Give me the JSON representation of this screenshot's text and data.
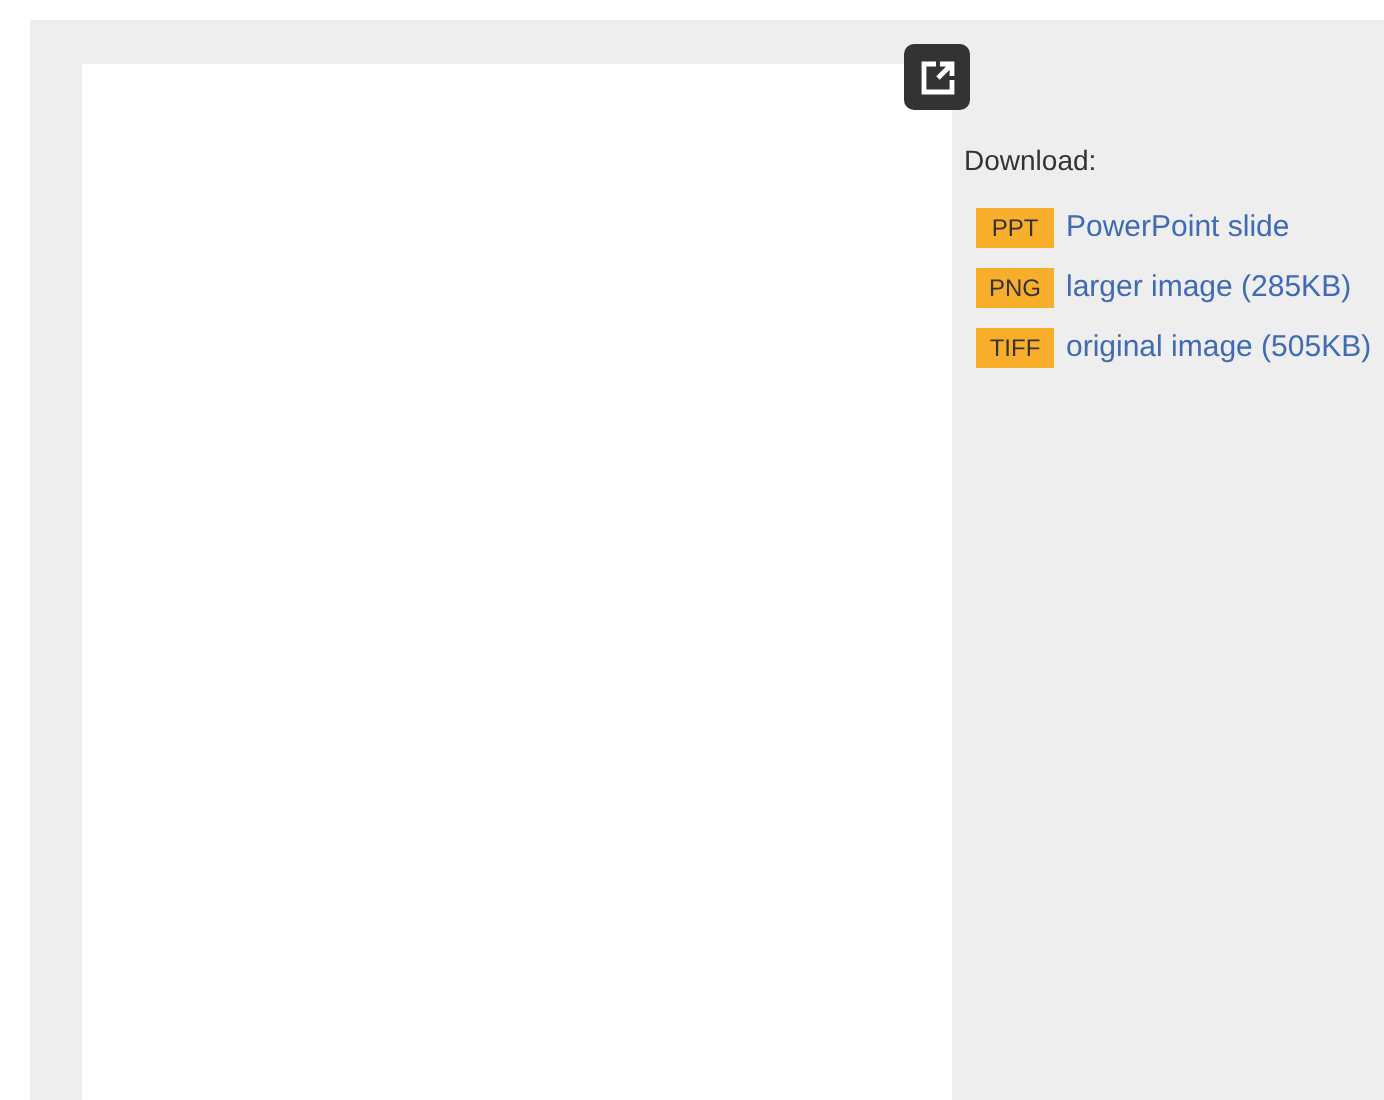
{
  "download": {
    "label": "Download:",
    "links": [
      {
        "badge": "PPT",
        "text": "PowerPoint slide"
      },
      {
        "badge": "PNG",
        "text": "larger image (285KB)"
      },
      {
        "badge": "TIFF",
        "text": "original image (505KB)"
      }
    ]
  }
}
